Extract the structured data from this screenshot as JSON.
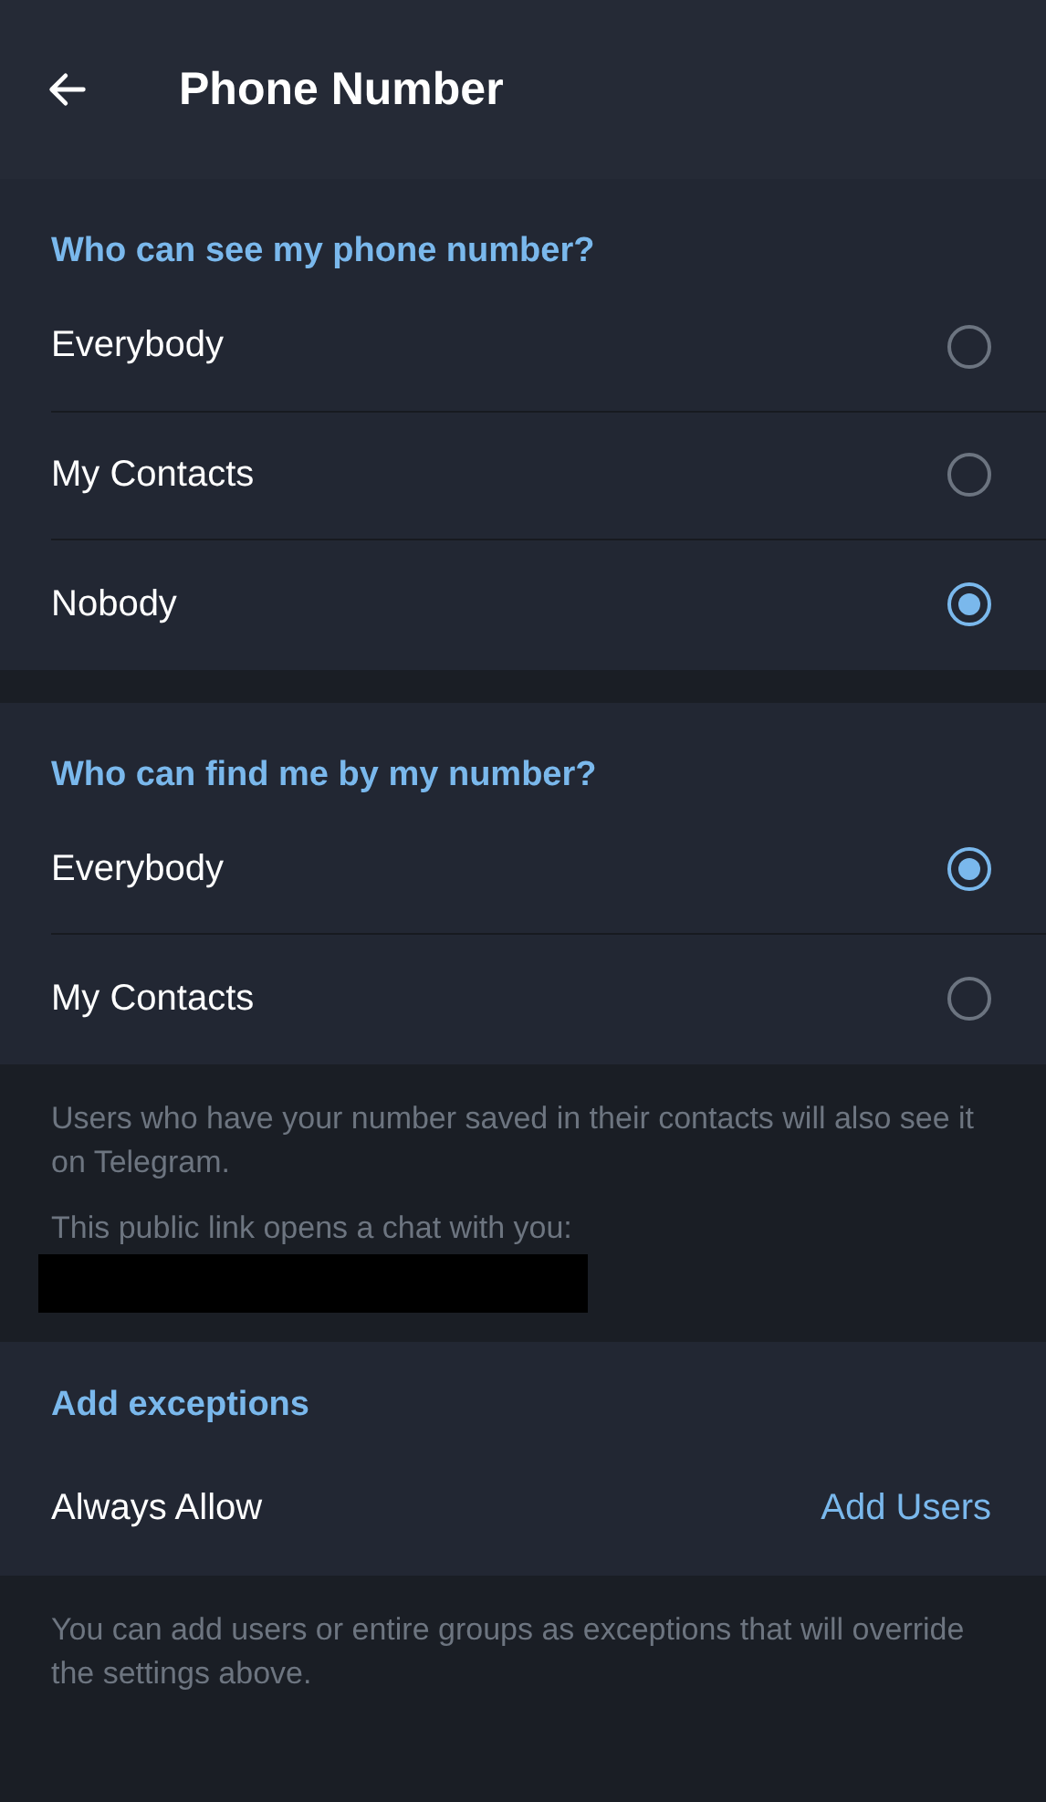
{
  "header": {
    "title": "Phone Number"
  },
  "sections": [
    {
      "heading": "Who can see my phone number?",
      "options": [
        {
          "label": "Everybody",
          "selected": false
        },
        {
          "label": "My Contacts",
          "selected": false
        },
        {
          "label": "Nobody",
          "selected": true
        }
      ]
    },
    {
      "heading": "Who can find me by my number?",
      "options": [
        {
          "label": "Everybody",
          "selected": true
        },
        {
          "label": "My Contacts",
          "selected": false
        }
      ]
    }
  ],
  "info": [
    "Users who have your number saved in their contacts will also see it on Telegram.",
    "This public link opens a chat with you:"
  ],
  "exceptions": {
    "heading": "Add exceptions",
    "label": "Always Allow",
    "action": "Add Users"
  },
  "footer_note": "You can add users or entire groups as exceptions that will override the settings above."
}
